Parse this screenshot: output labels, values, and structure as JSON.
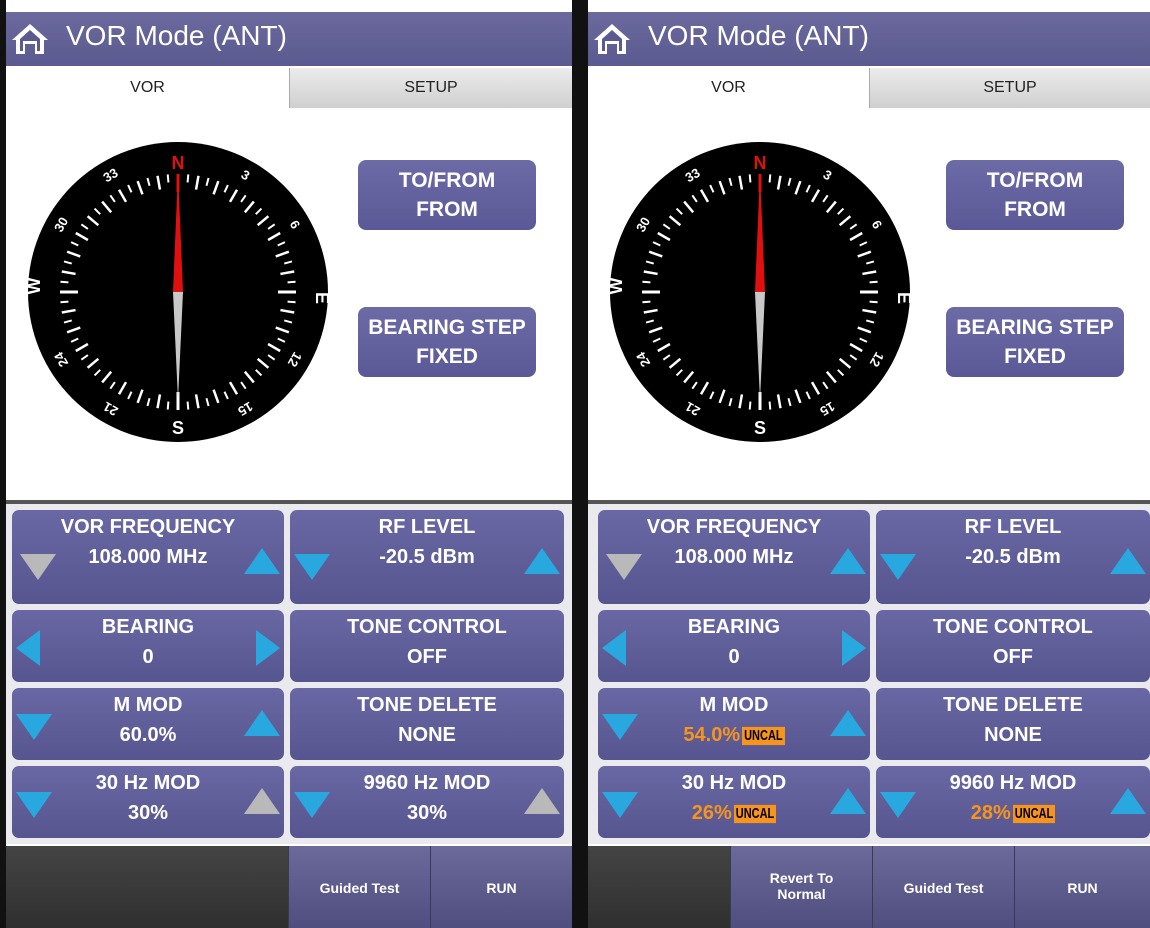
{
  "colors": {
    "accent": "#5b5a90",
    "arrow_active": "#29a8e0",
    "arrow_disabled": "#b9b9b9",
    "warning": "#f7941d",
    "needle_north": "#e01010"
  },
  "compass": {
    "cardinals": {
      "north": "N",
      "east": "E",
      "south": "S",
      "west": "W"
    },
    "numbers": [
      "3",
      "6",
      "12",
      "15",
      "21",
      "24",
      "30",
      "33"
    ]
  },
  "left": {
    "title": "VOR Mode (ANT)",
    "tabs": {
      "vor": "VOR",
      "setup": "SETUP"
    },
    "to_from": {
      "label": "TO/FROM",
      "value": "FROM"
    },
    "bearing_step": {
      "label": "BEARING STEP",
      "value": "FIXED"
    },
    "vor_frequency": {
      "label": "VOR FREQUENCY",
      "value": "108.000 MHz"
    },
    "rf_level": {
      "label": "RF LEVEL",
      "value": "-20.5 dBm"
    },
    "bearing": {
      "label": "BEARING",
      "value": "0"
    },
    "tone_control": {
      "label": "TONE CONTROL",
      "value": "OFF"
    },
    "m_mod": {
      "label": "M MOD",
      "value": "60.0%"
    },
    "tone_delete": {
      "label": "TONE DELETE",
      "value": "NONE"
    },
    "mod_30hz": {
      "label": "30 Hz MOD",
      "value": "30%"
    },
    "mod_9960hz": {
      "label": "9960 Hz MOD",
      "value": "30%"
    },
    "bottom": {
      "guided_test": "Guided Test",
      "run": "RUN"
    }
  },
  "right": {
    "title": "VOR Mode (ANT)",
    "tabs": {
      "vor": "VOR",
      "setup": "SETUP"
    },
    "to_from": {
      "label": "TO/FROM",
      "value": "FROM"
    },
    "bearing_step": {
      "label": "BEARING STEP",
      "value": "FIXED"
    },
    "vor_frequency": {
      "label": "VOR FREQUENCY",
      "value": "108.000 MHz"
    },
    "rf_level": {
      "label": "RF LEVEL",
      "value": "-20.5 dBm"
    },
    "bearing": {
      "label": "BEARING",
      "value": "0"
    },
    "tone_control": {
      "label": "TONE CONTROL",
      "value": "OFF"
    },
    "m_mod": {
      "label": "M MOD",
      "value": "54.0%",
      "badge": "UNCAL"
    },
    "tone_delete": {
      "label": "TONE DELETE",
      "value": "NONE"
    },
    "mod_30hz": {
      "label": "30 Hz MOD",
      "value": "26%",
      "badge": "UNCAL"
    },
    "mod_9960hz": {
      "label": "9960 Hz MOD",
      "value": "28%",
      "badge": "UNCAL"
    },
    "bottom": {
      "revert_line1": "Revert To",
      "revert_line2": "Normal",
      "guided_test": "Guided Test",
      "run": "RUN"
    }
  }
}
